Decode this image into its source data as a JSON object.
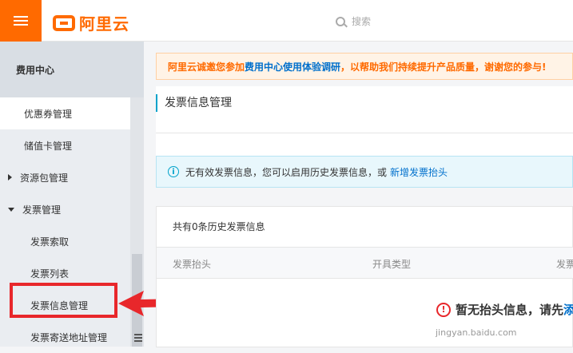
{
  "header": {
    "logo_text": "阿里云",
    "search_placeholder": "搜索"
  },
  "sidebar": {
    "title": "费用中心",
    "items": [
      {
        "label": "优惠券管理"
      },
      {
        "label": "储值卡管理"
      },
      {
        "label": "资源包管理"
      },
      {
        "label": "发票管理"
      },
      {
        "label": "发票索取"
      },
      {
        "label": "发票列表"
      },
      {
        "label": "发票信息管理"
      },
      {
        "label": "发票寄送地址管理"
      }
    ]
  },
  "main": {
    "banner": {
      "prefix": "阿里云诚邀您参加",
      "link": "费用中心使用体验调研",
      "suffix": "，以帮助我们持续提升产品质量，谢谢您的参与!"
    },
    "page_title": "发票信息管理",
    "notice": {
      "text": "无有效发票信息，您可以启用历史发票信息，或",
      "link": "新增发票抬头"
    },
    "records": {
      "count_text": "共有0条历史发票信息",
      "columns": [
        "发票抬头",
        "开具类型",
        "发票"
      ],
      "empty_text": "暂无抬头信息，请先",
      "empty_link": "添"
    }
  },
  "watermark": "jingyan.baidu.com",
  "colors": {
    "accent": "#ff6a00",
    "link": "#0070cc",
    "highlight": "#e8272b"
  }
}
